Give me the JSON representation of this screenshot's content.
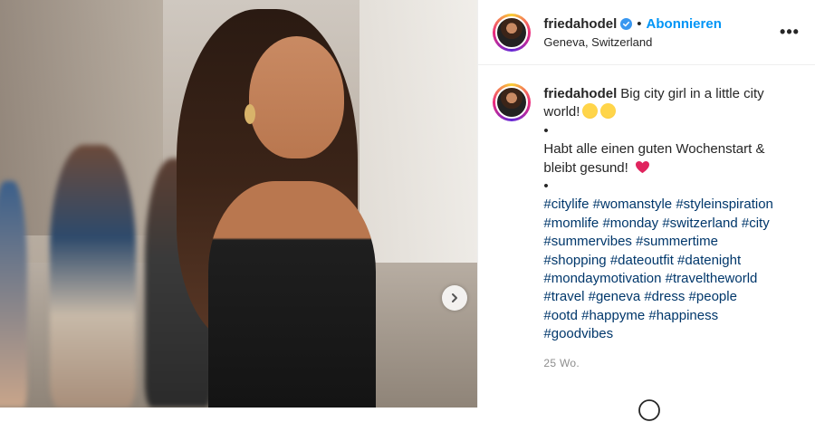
{
  "post": {
    "username": "friedahodel",
    "follow_label": "Abonnieren",
    "location": "Geneva, Switzerland",
    "more_label": "•••",
    "caption_lines": [
      "Big city girl in a little city world!",
      "•",
      "Habt alle einen guten Wochenstart & bleibt gesund!",
      "•"
    ],
    "hashtags": [
      "#citylife",
      "#womanstyle",
      "#styleinspiration",
      "#momlife",
      "#monday",
      "#switzerland",
      "#city",
      "#summervibes",
      "#summertime",
      "#shopping",
      "#dateoutfit",
      "#datenight",
      "#mondaymotivation",
      "#traveltheworld",
      "#travel",
      "#geneva",
      "#dress",
      "#people",
      "#ootd",
      "#happyme",
      "#happiness",
      "#goodvibes"
    ],
    "timestamp": "25 Wo."
  },
  "colors": {
    "link_blue": "#0095f6",
    "hashtag": "#00376b",
    "muted": "#8e8e8e"
  },
  "icons": [
    "verified-badge-icon",
    "chevron-right-icon",
    "more-options-icon",
    "wink-emoji-icon",
    "kiss-emoji-icon",
    "heart-emoji-icon",
    "emoji-smiley-icon"
  ]
}
